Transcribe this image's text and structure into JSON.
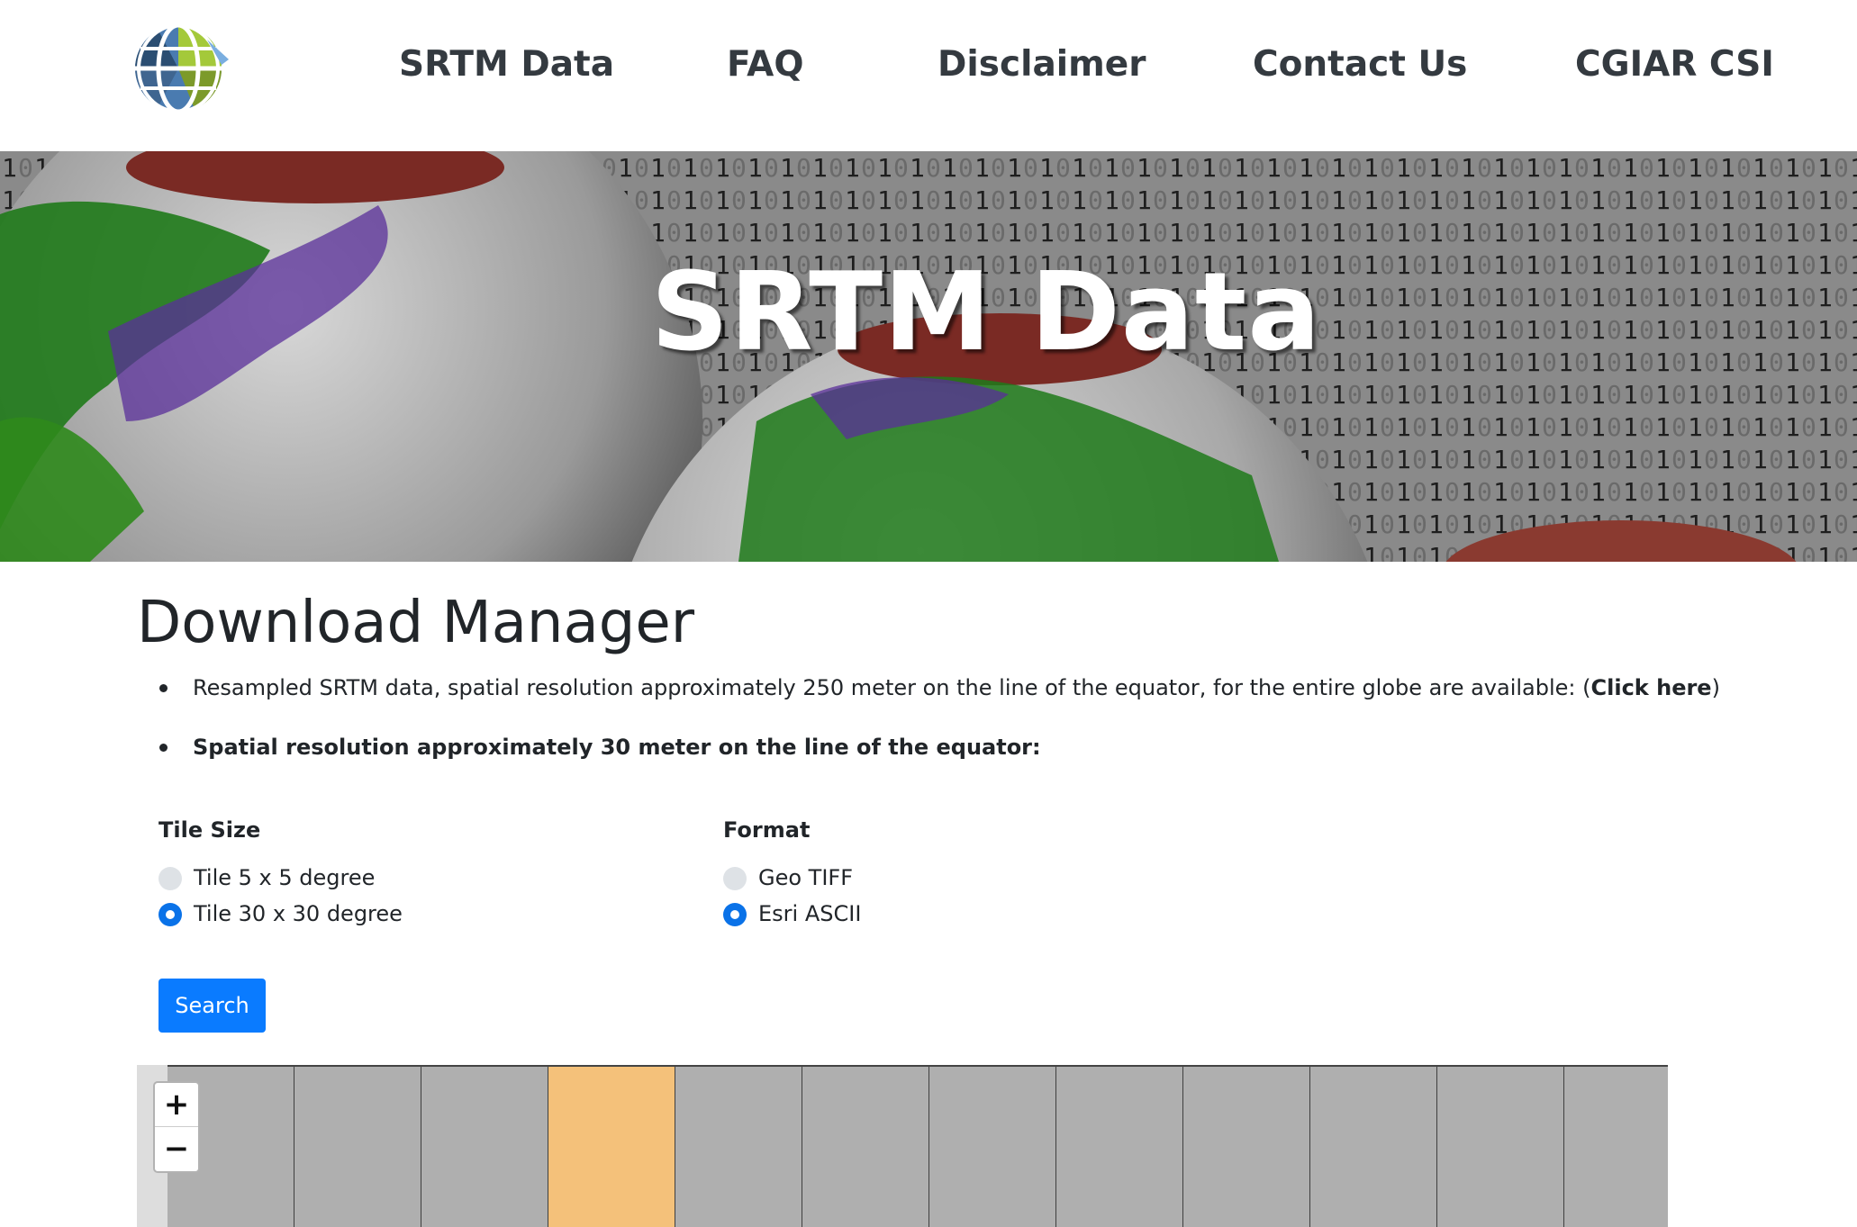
{
  "colors": {
    "primary": "#0a7bff",
    "radio_checked": "#0a72e8",
    "selected_tile": "#f4c17a",
    "tile": "#afafaf"
  },
  "nav": {
    "logo_icon": "globe-icon",
    "items": [
      {
        "label": "SRTM Data"
      },
      {
        "label": "FAQ"
      },
      {
        "label": "Disclaimer"
      },
      {
        "label": "Contact Us"
      },
      {
        "label": "CGIAR CSI"
      }
    ]
  },
  "hero": {
    "title": "SRTM Data"
  },
  "main": {
    "title": "Download Manager",
    "bullet1": {
      "text": "Resampled SRTM data, spatial resolution approximately 250 meter on the line of the equator, for the entire globe are available: (",
      "link": "Click here",
      "suffix": ")"
    },
    "bullet2": {
      "text": "Spatial resolution approximately 30 meter on the line of the equator:"
    }
  },
  "form": {
    "tile_size": {
      "label": "Tile Size",
      "options": [
        {
          "label": "Tile 5 x 5 degree",
          "checked": false
        },
        {
          "label": "Tile 30 x 30 degree",
          "checked": true
        }
      ]
    },
    "format": {
      "label": "Format",
      "options": [
        {
          "label": "Geo TIFF",
          "checked": false
        },
        {
          "label": "Esri ASCII",
          "checked": true
        }
      ]
    },
    "search_label": "Search"
  },
  "map": {
    "zoom_in": "+",
    "zoom_out": "−",
    "tile_count": 12,
    "selected_tile_index": 3
  }
}
